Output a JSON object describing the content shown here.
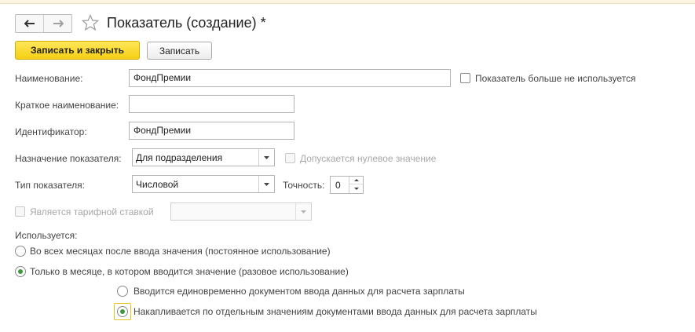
{
  "window": {
    "title": "Показатель (создание) *"
  },
  "toolbar": {
    "save_close_label": "Записать и закрыть",
    "save_label": "Записать"
  },
  "form": {
    "name_label": "Наименование:",
    "name_value": "ФондПремии",
    "not_used_label": "Показатель больше не используется",
    "short_name_label": "Краткое наименование:",
    "short_name_value": "",
    "identifier_label": "Идентификатор:",
    "identifier_value": "ФондПремии",
    "purpose_label": "Назначение показателя:",
    "purpose_value": "Для подразделения",
    "zero_allowed_label": "Допускается нулевое значение",
    "type_label": "Тип показателя:",
    "type_value": "Числовой",
    "precision_label": "Точность:",
    "precision_value": "0",
    "tariff_label": "Является тарифной ставкой",
    "tariff_value": ""
  },
  "usage": {
    "title": "Используется:",
    "option_permanent": "Во всех месяцах после ввода значения (постоянное использование)",
    "option_once": "Только в месяце, в котором вводится значение (разовое использование)",
    "sub_option_single": "Вводится единовременно документом ввода данных для расчета зарплаты",
    "sub_option_accumulated": "Накапливается по отдельным значениям документами ввода данных для расчета зарплаты"
  },
  "state": {
    "not_used_checked": false,
    "zero_allowed_checked": false,
    "tariff_checked": false,
    "usage_selected": "once",
    "sub_usage_selected": "accumulated"
  },
  "icons": {
    "back": "arrow-left-icon",
    "forward": "arrow-right-icon",
    "favorite": "star-outline-icon",
    "dropdown": "chevron-down-icon",
    "spin": "spin-up-down-icon"
  },
  "colors": {
    "primary_button": "#f5cf12",
    "radio_dot": "#3c9a3c",
    "focus_frame": "#e8c11a"
  }
}
